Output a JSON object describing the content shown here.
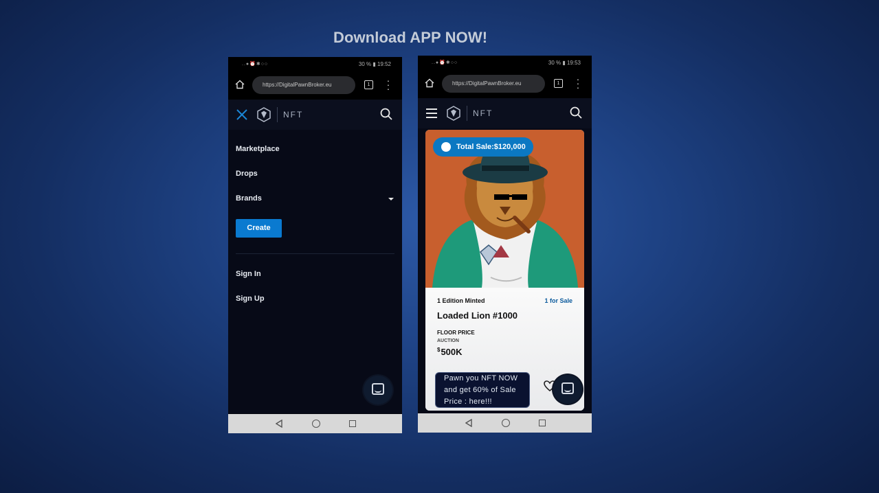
{
  "headline": "Download APP NOW!",
  "left_phone": {
    "status": {
      "icons": "..●⏰✱○○",
      "battery": "30 %",
      "time": "19:52"
    },
    "browser": {
      "url": "https://DigitalPawnBroker.eu",
      "tab_count": "1"
    },
    "header": {
      "logo_text": "NFT"
    },
    "menu": {
      "items": [
        "Marketplace",
        "Drops",
        "Brands"
      ],
      "create_label": "Create",
      "auth_items": [
        "Sign In",
        "Sign Up"
      ]
    }
  },
  "right_phone": {
    "status": {
      "icons": "..●⏰✱○○",
      "battery": "30 %",
      "time": "19:53"
    },
    "browser": {
      "url": "https://DigitalPawnBroker.eu",
      "tab_count": "1"
    },
    "header": {
      "logo_text": "NFT"
    },
    "card": {
      "total_sale": "Total Sale:$120,000",
      "edition": "1 Edition Minted",
      "for_sale": "1 for Sale",
      "name": "Loaded Lion #1000",
      "floor_label": "FLOOR PRICE",
      "auction_label": "AUCTION",
      "currency": "$",
      "price": "500K"
    },
    "pawn_message": "Pawn you NFT NOW and get  60% of Sale Price : here!!!"
  }
}
